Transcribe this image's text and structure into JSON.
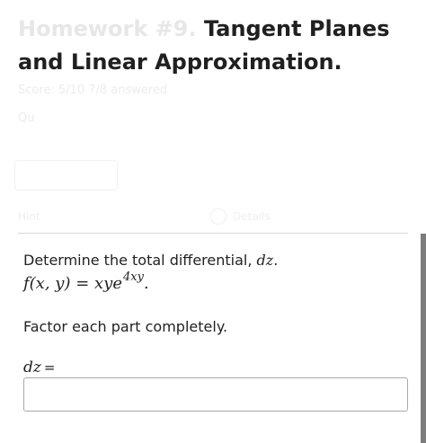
{
  "header": {
    "title_faded": "Homework #9.",
    "title_main": " Tangent Planes and Linear Approximation.",
    "meta_line": "Score: 5/10  7/8 answered",
    "meta_short": "Qu"
  },
  "controls": {
    "left_text": "Hint",
    "right_text": "Details"
  },
  "question": {
    "prompt_text": "Determine the total differential, ",
    "prompt_math": "dz",
    "prompt_end": ".",
    "formula_left": "f(x, y) = xye",
    "formula_exp": "4xy",
    "formula_end": ".",
    "instruction": "Factor each part completely.",
    "answer_label_math": "dz",
    "answer_label_eq": "=",
    "answer_value": "",
    "answer_placeholder": ""
  },
  "colors": {
    "text": "#222222",
    "faded_text": "#e7e7e7",
    "divider": "#d8d8d8",
    "input_border": "#a9a9a9",
    "scroll_bar": "#7d7d7d"
  }
}
